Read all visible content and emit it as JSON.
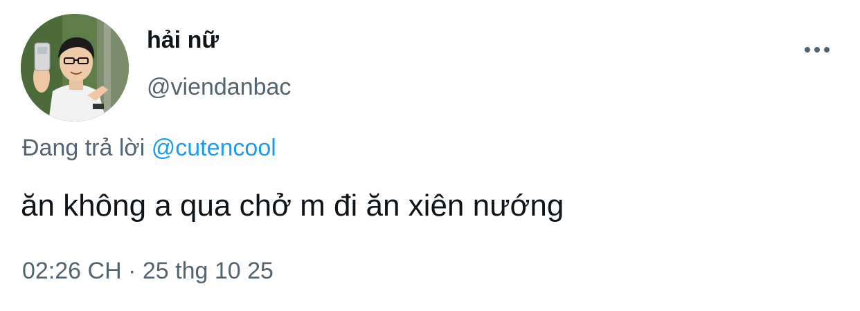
{
  "tweet": {
    "author": {
      "display_name": "hải nữ",
      "handle": "@viendanbac",
      "avatar_icon": "user-avatar"
    },
    "more_icon": "more-horizontal-icon",
    "reply": {
      "prefix": "Đang trả lời",
      "mention": "@cutencool"
    },
    "text": "ăn không a qua chở m đi ăn xiên nướng",
    "time": "02:26 CH",
    "separator": "·",
    "date": "25 thg 10 25"
  },
  "colors": {
    "text_primary": "#0f1419",
    "text_secondary": "#536471",
    "link": "#1d9bf0",
    "background": "#ffffff"
  }
}
